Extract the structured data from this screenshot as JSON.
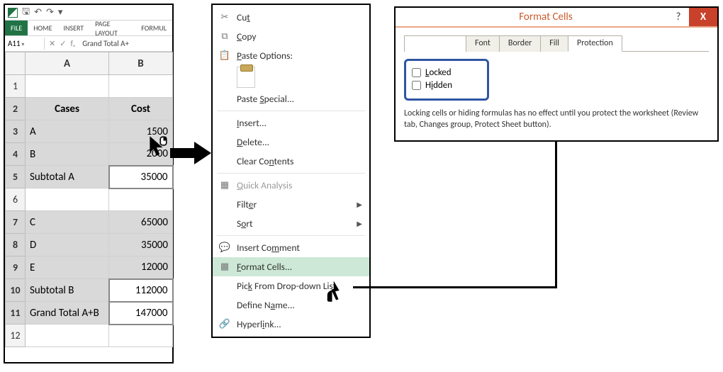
{
  "excel": {
    "qat_icons": [
      "excel-icon",
      "save-icon",
      "undo-icon",
      "redo-icon",
      "customize-icon"
    ],
    "tabs": [
      "FILE",
      "HOME",
      "INSERT",
      "PAGE LAYOUT",
      "FORMUL"
    ],
    "active_tab_index": 0,
    "name_box": "A11",
    "fx_icons": {
      "cancel": "✕",
      "enter": "✓",
      "fx": "fₓ"
    },
    "formula": "Grand Total A+",
    "col_headers": [
      "A",
      "B"
    ],
    "row_headers": [
      "1",
      "2",
      "3",
      "4",
      "5",
      "6",
      "7",
      "8",
      "9",
      "10",
      "11",
      "12"
    ],
    "grid": {
      "header_row": {
        "A": "Cases",
        "B": "Cost"
      },
      "rows": [
        {
          "A": "A",
          "B": "1500"
        },
        {
          "A": "B",
          "B": "2000"
        },
        {
          "A": "Subtotal A",
          "B": "35000",
          "white_B": true
        },
        {
          "A": "",
          "B": ""
        },
        {
          "A": "C",
          "B": "65000"
        },
        {
          "A": "D",
          "B": "35000"
        },
        {
          "A": "E",
          "B": "12000"
        },
        {
          "A": "Subtotal B",
          "B": "112000",
          "white_B": true
        },
        {
          "A": "Grand Total A+B",
          "B": "147000",
          "white_B": true
        }
      ]
    },
    "selected_rows": [
      2,
      3,
      4,
      5,
      7,
      8,
      9,
      10,
      11
    ]
  },
  "context_menu": {
    "items": {
      "cut": "Cut",
      "copy": "Copy",
      "paste_options": "Paste Options:",
      "paste_special": "Paste Special...",
      "insert": "Insert...",
      "delete": "Delete...",
      "clear_contents": "Clear Contents",
      "quick_analysis": "Quick Analysis",
      "filter": "Filter",
      "sort": "Sort",
      "insert_comment": "Insert Comment",
      "format_cells": "Format Cells...",
      "pick_dropdown": "Pick From Drop-down List",
      "define_name": "Define Name...",
      "hyperlink": "Hyperlink..."
    }
  },
  "dialog": {
    "title": "Format Cells",
    "help": "?",
    "close": "X",
    "tabs": [
      "",
      "Font",
      "Border",
      "Fill",
      "Protection"
    ],
    "protection": {
      "locked": "Locked",
      "hidden": "Hidden"
    },
    "note": "Locking cells or hiding formulas has no effect until you protect the worksheet (Review tab, Changes group, Protect Sheet button)."
  }
}
